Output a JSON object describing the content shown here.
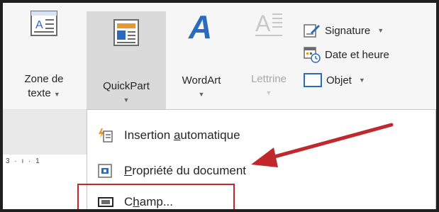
{
  "ribbon": {
    "text_box": {
      "line1": "Zone de",
      "line2": "texte"
    },
    "quickpart": {
      "label": "QuickPart"
    },
    "wordart": {
      "label": "WordArt"
    },
    "dropcap": {
      "label": "Lettrine"
    },
    "signature": {
      "label": "Signature"
    },
    "datetime": {
      "label": "Date et heure"
    },
    "object": {
      "label": "Objet"
    }
  },
  "ruler": {
    "text": "3 · ı · 1"
  },
  "menu": {
    "items": [
      {
        "label": "Insertion automatique",
        "icon": "autotext-icon",
        "access_key": "a"
      },
      {
        "label": "Propriété du document",
        "icon": "document-property-icon",
        "access_key": "P"
      },
      {
        "label": "Champ...",
        "icon": "field-icon",
        "access_key": "h"
      }
    ]
  },
  "colors": {
    "annotation": "#c0282d",
    "accent": "#2b6bbf",
    "ribbon_bg": "#f6f6f6",
    "selected_bg": "#dadada"
  }
}
